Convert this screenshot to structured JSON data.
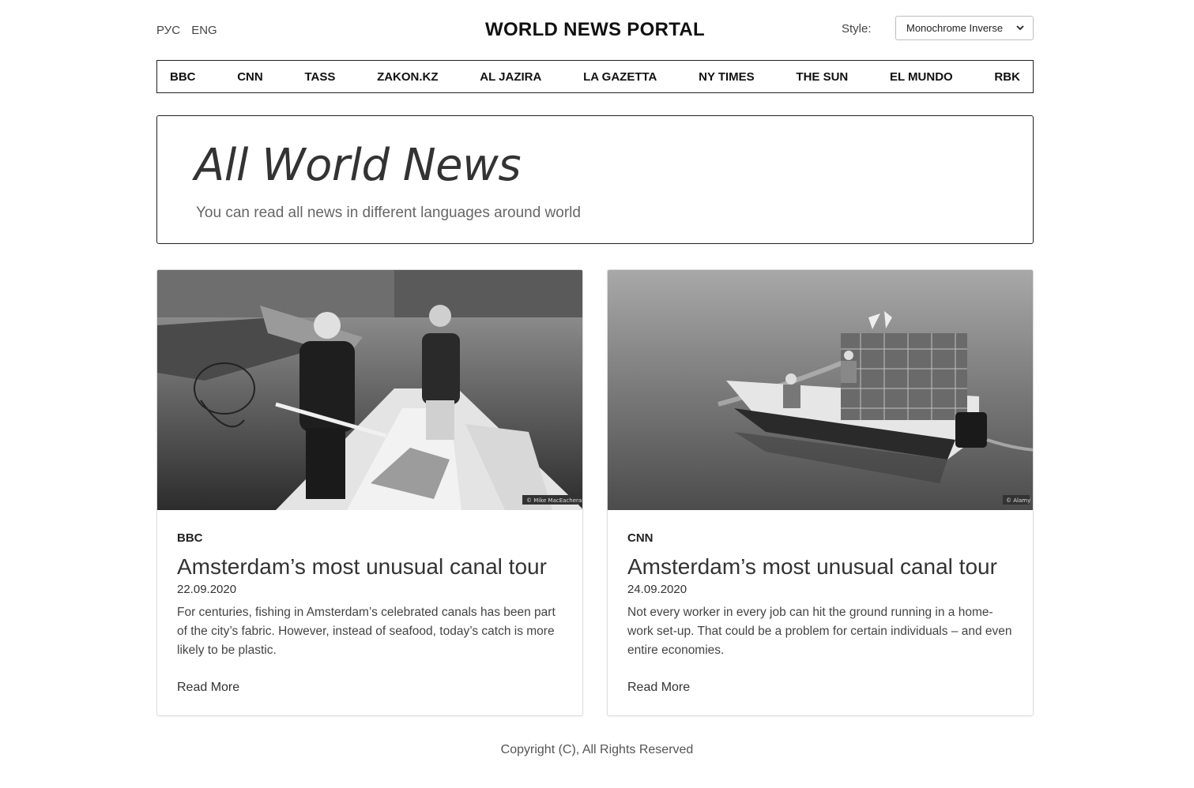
{
  "header": {
    "languages": [
      "РУС",
      "ENG"
    ],
    "title": "WORLD NEWS PORTAL",
    "style_label": "Style:",
    "style_value": "Monochrome Inverse"
  },
  "nav": {
    "items": [
      "BBC",
      "CNN",
      "TASS",
      "ZAKON.KZ",
      "AL JAZIRA",
      "LA GAZETTA",
      "NY TIMES",
      "THE SUN",
      "EL MUNDO",
      "RBK"
    ]
  },
  "hero": {
    "title": "All World News",
    "subtitle": "You can read all news in different languages around world"
  },
  "cards": [
    {
      "source": "BBC",
      "title": "Amsterdam’s most unusual canal tour",
      "date": "22.09.2020",
      "text": "For centuries, fishing in Amsterdam’s celebrated canals has been part of the city’s fabric. However, instead of seafood, today’s catch is more likely to be plastic.",
      "more": "Read More",
      "image_caption": "© Mike MacEacheran"
    },
    {
      "source": "CNN",
      "title": "Amsterdam’s most unusual canal tour",
      "date": "24.09.2020",
      "text": "Not every worker in every job can hit the ground running in a home-work set-up. That could be a problem for certain individuals – and even entire economies.",
      "more": "Read More",
      "image_caption": "© Alamy"
    }
  ],
  "footer": {
    "copyright": "Copyright (C), All Rights Reserved"
  }
}
